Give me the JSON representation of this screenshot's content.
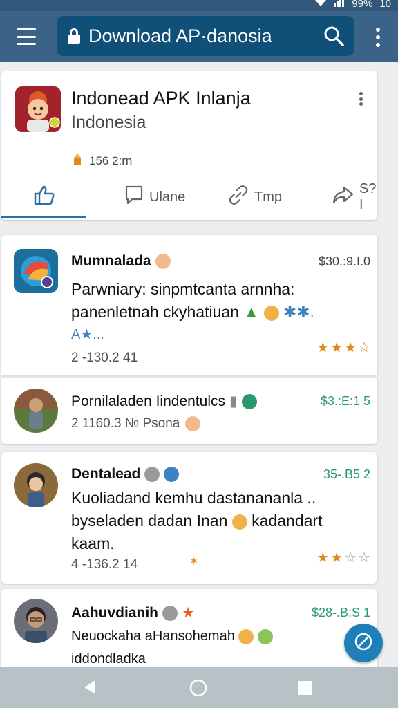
{
  "status_bar": {
    "battery": "99%",
    "time": "10"
  },
  "app_bar": {
    "search_text": "Download AP·danosia"
  },
  "featured": {
    "title": "Indonead APK Inlanja",
    "subtitle": "Indonesia",
    "meta": "156 2:rn",
    "tabs": [
      {
        "label": ""
      },
      {
        "label": "Ulane"
      },
      {
        "label": "Tmp"
      },
      {
        "label": "S?I"
      }
    ]
  },
  "posts": [
    {
      "name": "Mumnalada",
      "price": "$30.:9.I.0",
      "body_line1": "Parwniary:  sinpmtcanta arnnha:",
      "body_line2": "panenletnah ckyhatiuan",
      "body_line3": "A★...",
      "meta": "2 -130.2 41",
      "rating": 3
    },
    {
      "name": "Pornilaladen Iindentulcs",
      "price": "$3.:E:1 5",
      "meta": "2  1160.3 № Psona"
    },
    {
      "name": "Dentalead",
      "price": "35-.B5 2",
      "body_line1": "Kuoliadand kemhu dastanananla ..",
      "body_line2": "byseladen dadan Inan",
      "body_line2b": "kadandart",
      "body_line3": "kaam.",
      "meta": "4 -136.2 14",
      "rating": 2
    },
    {
      "name": "Aahuvdianih",
      "price": "$28-.B:S 1",
      "body_line1": "Neuockaha aHansohemah",
      "body_line2": "iddondladka"
    }
  ],
  "colors": {
    "app_bar": "#3b6388",
    "search_box": "#0f4f78",
    "accent": "#2a6fa5",
    "price_green": "#2a9a6e",
    "star": "#e08a1e",
    "fab": "#1f7fb8"
  }
}
